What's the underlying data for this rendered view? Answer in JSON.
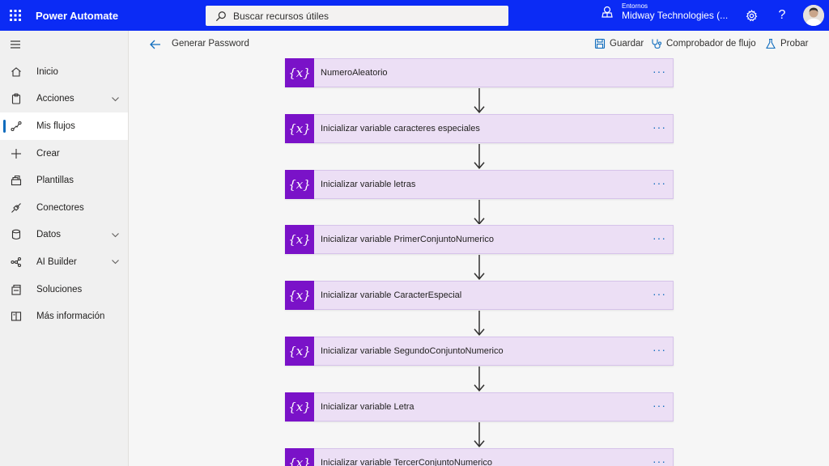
{
  "topbar": {
    "app_name": "Power Automate",
    "search_placeholder": "Buscar recursos útiles",
    "env_label": "Entornos",
    "env_name": "Midway Technologies (..."
  },
  "sidebar": {
    "items": [
      {
        "label": "Inicio",
        "icon": "home-icon"
      },
      {
        "label": "Acciones",
        "icon": "clipboard-icon",
        "expandable": true
      },
      {
        "label": "Mis flujos",
        "icon": "flow-icon",
        "active": true
      },
      {
        "label": "Crear",
        "icon": "plus-icon"
      },
      {
        "label": "Plantillas",
        "icon": "templates-icon"
      },
      {
        "label": "Conectores",
        "icon": "connector-icon"
      },
      {
        "label": "Datos",
        "icon": "database-icon",
        "expandable": true
      },
      {
        "label": "AI Builder",
        "icon": "ai-builder-icon",
        "expandable": true
      },
      {
        "label": "Soluciones",
        "icon": "solutions-icon"
      },
      {
        "label": "Más información",
        "icon": "book-icon"
      }
    ]
  },
  "commandbar": {
    "flow_name": "Generar Password",
    "save_label": "Guardar",
    "checker_label": "Comprobador de flujo",
    "test_label": "Probar"
  },
  "flow": {
    "icon_text": "{x}",
    "more_text": "···",
    "steps": [
      "NumeroAleatorio",
      "Inicializar variable caracteres especiales",
      "Inicializar variable letras",
      "Inicializar variable PrimerConjuntoNumerico",
      "Inicializar variable CaracterEspecial",
      "Inicializar variable SegundoConjuntoNumerico",
      "Inicializar variable Letra",
      "Inicializar variable TercerConjuntoNumerico"
    ]
  },
  "colors": {
    "topbar": "#0b2bf5",
    "card_bg": "#ecdff5",
    "card_icon_bg": "#7a12c8",
    "accent": "#0f6cbd"
  }
}
